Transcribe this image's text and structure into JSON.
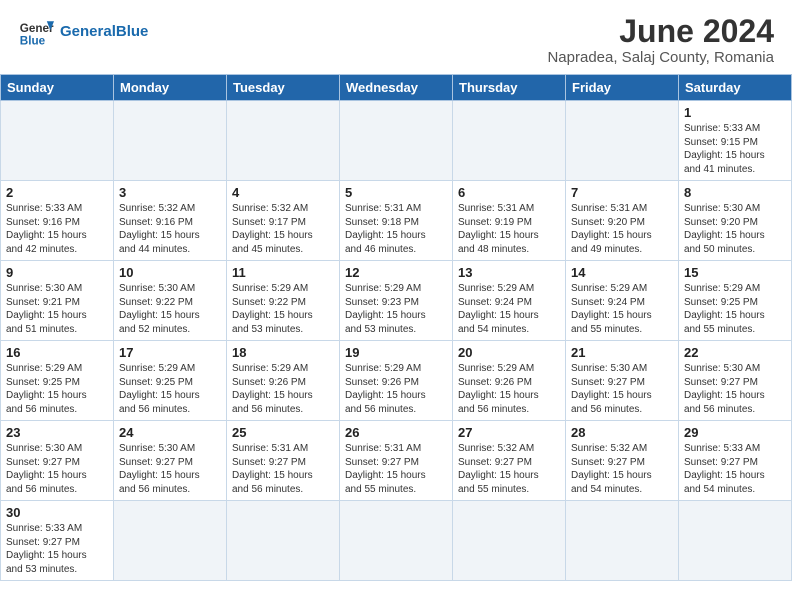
{
  "header": {
    "logo_general": "General",
    "logo_blue": "Blue",
    "title": "June 2024",
    "subtitle": "Napradea, Salaj County, Romania"
  },
  "days_of_week": [
    "Sunday",
    "Monday",
    "Tuesday",
    "Wednesday",
    "Thursday",
    "Friday",
    "Saturday"
  ],
  "weeks": [
    [
      {
        "day": "",
        "info": ""
      },
      {
        "day": "",
        "info": ""
      },
      {
        "day": "",
        "info": ""
      },
      {
        "day": "",
        "info": ""
      },
      {
        "day": "",
        "info": ""
      },
      {
        "day": "",
        "info": ""
      },
      {
        "day": "1",
        "info": "Sunrise: 5:33 AM\nSunset: 9:15 PM\nDaylight: 15 hours\nand 41 minutes."
      }
    ],
    [
      {
        "day": "2",
        "info": "Sunrise: 5:33 AM\nSunset: 9:16 PM\nDaylight: 15 hours\nand 42 minutes."
      },
      {
        "day": "3",
        "info": "Sunrise: 5:32 AM\nSunset: 9:16 PM\nDaylight: 15 hours\nand 44 minutes."
      },
      {
        "day": "4",
        "info": "Sunrise: 5:32 AM\nSunset: 9:17 PM\nDaylight: 15 hours\nand 45 minutes."
      },
      {
        "day": "5",
        "info": "Sunrise: 5:31 AM\nSunset: 9:18 PM\nDaylight: 15 hours\nand 46 minutes."
      },
      {
        "day": "6",
        "info": "Sunrise: 5:31 AM\nSunset: 9:19 PM\nDaylight: 15 hours\nand 48 minutes."
      },
      {
        "day": "7",
        "info": "Sunrise: 5:31 AM\nSunset: 9:20 PM\nDaylight: 15 hours\nand 49 minutes."
      },
      {
        "day": "8",
        "info": "Sunrise: 5:30 AM\nSunset: 9:20 PM\nDaylight: 15 hours\nand 50 minutes."
      }
    ],
    [
      {
        "day": "9",
        "info": "Sunrise: 5:30 AM\nSunset: 9:21 PM\nDaylight: 15 hours\nand 51 minutes."
      },
      {
        "day": "10",
        "info": "Sunrise: 5:30 AM\nSunset: 9:22 PM\nDaylight: 15 hours\nand 52 minutes."
      },
      {
        "day": "11",
        "info": "Sunrise: 5:29 AM\nSunset: 9:22 PM\nDaylight: 15 hours\nand 53 minutes."
      },
      {
        "day": "12",
        "info": "Sunrise: 5:29 AM\nSunset: 9:23 PM\nDaylight: 15 hours\nand 53 minutes."
      },
      {
        "day": "13",
        "info": "Sunrise: 5:29 AM\nSunset: 9:24 PM\nDaylight: 15 hours\nand 54 minutes."
      },
      {
        "day": "14",
        "info": "Sunrise: 5:29 AM\nSunset: 9:24 PM\nDaylight: 15 hours\nand 55 minutes."
      },
      {
        "day": "15",
        "info": "Sunrise: 5:29 AM\nSunset: 9:25 PM\nDaylight: 15 hours\nand 55 minutes."
      }
    ],
    [
      {
        "day": "16",
        "info": "Sunrise: 5:29 AM\nSunset: 9:25 PM\nDaylight: 15 hours\nand 56 minutes."
      },
      {
        "day": "17",
        "info": "Sunrise: 5:29 AM\nSunset: 9:25 PM\nDaylight: 15 hours\nand 56 minutes."
      },
      {
        "day": "18",
        "info": "Sunrise: 5:29 AM\nSunset: 9:26 PM\nDaylight: 15 hours\nand 56 minutes."
      },
      {
        "day": "19",
        "info": "Sunrise: 5:29 AM\nSunset: 9:26 PM\nDaylight: 15 hours\nand 56 minutes."
      },
      {
        "day": "20",
        "info": "Sunrise: 5:29 AM\nSunset: 9:26 PM\nDaylight: 15 hours\nand 56 minutes."
      },
      {
        "day": "21",
        "info": "Sunrise: 5:30 AM\nSunset: 9:27 PM\nDaylight: 15 hours\nand 56 minutes."
      },
      {
        "day": "22",
        "info": "Sunrise: 5:30 AM\nSunset: 9:27 PM\nDaylight: 15 hours\nand 56 minutes."
      }
    ],
    [
      {
        "day": "23",
        "info": "Sunrise: 5:30 AM\nSunset: 9:27 PM\nDaylight: 15 hours\nand 56 minutes."
      },
      {
        "day": "24",
        "info": "Sunrise: 5:30 AM\nSunset: 9:27 PM\nDaylight: 15 hours\nand 56 minutes."
      },
      {
        "day": "25",
        "info": "Sunrise: 5:31 AM\nSunset: 9:27 PM\nDaylight: 15 hours\nand 56 minutes."
      },
      {
        "day": "26",
        "info": "Sunrise: 5:31 AM\nSunset: 9:27 PM\nDaylight: 15 hours\nand 55 minutes."
      },
      {
        "day": "27",
        "info": "Sunrise: 5:32 AM\nSunset: 9:27 PM\nDaylight: 15 hours\nand 55 minutes."
      },
      {
        "day": "28",
        "info": "Sunrise: 5:32 AM\nSunset: 9:27 PM\nDaylight: 15 hours\nand 54 minutes."
      },
      {
        "day": "29",
        "info": "Sunrise: 5:33 AM\nSunset: 9:27 PM\nDaylight: 15 hours\nand 54 minutes."
      }
    ],
    [
      {
        "day": "30",
        "info": "Sunrise: 5:33 AM\nSunset: 9:27 PM\nDaylight: 15 hours\nand 53 minutes."
      },
      {
        "day": "",
        "info": ""
      },
      {
        "day": "",
        "info": ""
      },
      {
        "day": "",
        "info": ""
      },
      {
        "day": "",
        "info": ""
      },
      {
        "day": "",
        "info": ""
      },
      {
        "day": "",
        "info": ""
      }
    ]
  ]
}
